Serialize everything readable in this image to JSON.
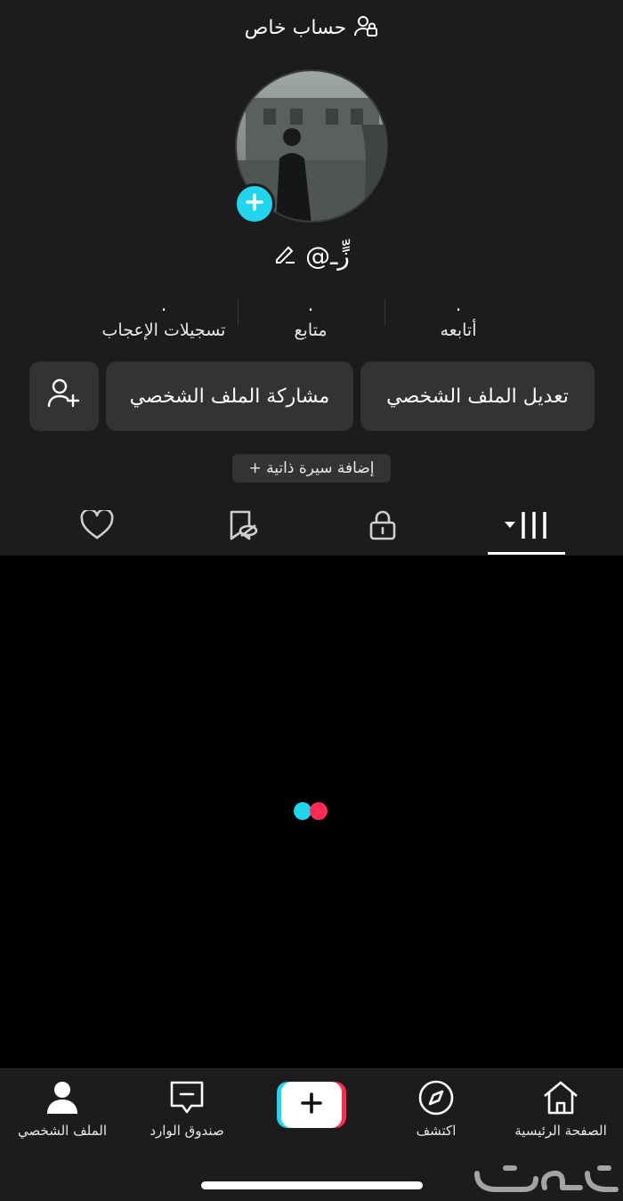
{
  "top_bar": {
    "title": "حساب خاص",
    "icon": "private-account-icon"
  },
  "profile": {
    "username": "@زٍَّـ",
    "avatar_icon": "avatar-photo",
    "add_icon": "plus-icon",
    "edit_icon": "pencil-icon"
  },
  "stats": [
    {
      "label": "أتابعه",
      "value": "."
    },
    {
      "label": "متابع",
      "value": "."
    },
    {
      "label": "تسجيلات الإعجاب",
      "value": "."
    }
  ],
  "buttons": {
    "edit_profile": "تعديل الملف الشخصي",
    "share_profile": "مشاركة الملف الشخصي",
    "add_friend_icon": "add-user-icon"
  },
  "bio": {
    "add_label": "+ إضافة سيرة ذاتية"
  },
  "tabs": [
    {
      "name": "videos",
      "icon": "grid-icon",
      "active": true
    },
    {
      "name": "private",
      "icon": "lock-icon",
      "active": false
    },
    {
      "name": "favorites-hidden",
      "icon": "bookmark-hidden-icon",
      "active": false
    },
    {
      "name": "liked",
      "icon": "heart-icon",
      "active": false
    }
  ],
  "bottom_nav": [
    {
      "label": "الصفحة الرئيسية",
      "icon": "home-icon"
    },
    {
      "label": "اكتشف",
      "icon": "compass-icon"
    },
    {
      "label": "",
      "icon": "plus-icon"
    },
    {
      "label": "صندوق الوارد",
      "icon": "inbox-icon"
    },
    {
      "label": "الملف الشخصي",
      "icon": "profile-icon"
    }
  ],
  "watermark": {
    "text": "حراج"
  },
  "colors": {
    "accent_cyan": "#20d5ec",
    "accent_red": "#fe2c55",
    "panel": "#1c1c1c",
    "button": "#333333"
  }
}
